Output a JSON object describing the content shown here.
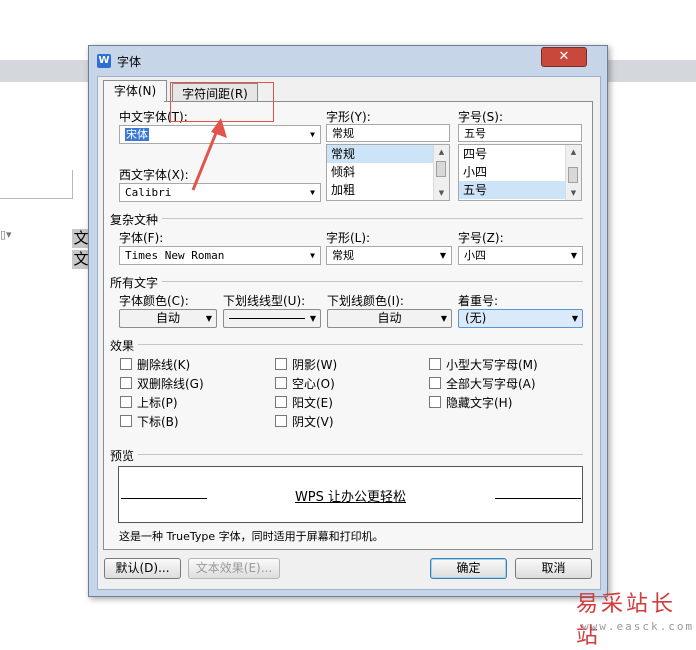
{
  "doc": {
    "chars": [
      "文",
      "文"
    ]
  },
  "dialog": {
    "title": "字体",
    "close_glyph": "✕",
    "app_icon_letter": "W",
    "tabs": [
      {
        "label": "字体(N)"
      },
      {
        "label": "字符间距(R)"
      }
    ]
  },
  "chinese": {
    "label": "中文字体(T):",
    "value": "宋体",
    "style_label": "字形(Y):",
    "style_value": "常规",
    "size_label": "字号(S):",
    "size_value": "五号",
    "style_options": [
      "常规",
      "倾斜",
      "加粗"
    ],
    "size_options": [
      "四号",
      "小四",
      "五号"
    ]
  },
  "western": {
    "label": "西文字体(X):",
    "value": "Calibri"
  },
  "complex": {
    "title": "复杂文种",
    "font_label": "字体(F):",
    "font_value": "Times New Roman",
    "style_label": "字形(L):",
    "style_value": "常规",
    "size_label": "字号(Z):",
    "size_value": "小四"
  },
  "all_text": {
    "title": "所有文字",
    "color_label": "字体颜色(C):",
    "color_value": "自动",
    "underline_label": "下划线线型(U):",
    "underline_color_label": "下划线颜色(I):",
    "underline_color_value": "自动",
    "emphasis_label": "着重号:",
    "emphasis_value": "(无)"
  },
  "effects": {
    "title": "效果",
    "col1": [
      "删除线(K)",
      "双删除线(G)",
      "上标(P)",
      "下标(B)"
    ],
    "col2": [
      "阴影(W)",
      "空心(O)",
      "阳文(E)",
      "阴文(V)"
    ],
    "col3": [
      "小型大写字母(M)",
      "全部大写字母(A)",
      "隐藏文字(H)"
    ]
  },
  "preview": {
    "title": "预览",
    "sample": "WPS 让办公更轻松",
    "note": "这是一种 TrueType 字体，同时适用于屏幕和打印机。"
  },
  "buttons": {
    "default": "默认(D)...",
    "text_effects": "文本效果(E)...",
    "ok": "确定",
    "cancel": "取消"
  },
  "watermark": {
    "name": "易采站长站",
    "url": "www.easck.com"
  },
  "colors": {
    "accent": "#e2534a",
    "title_bar": "#c7d5e8",
    "close": "#c9483c"
  }
}
